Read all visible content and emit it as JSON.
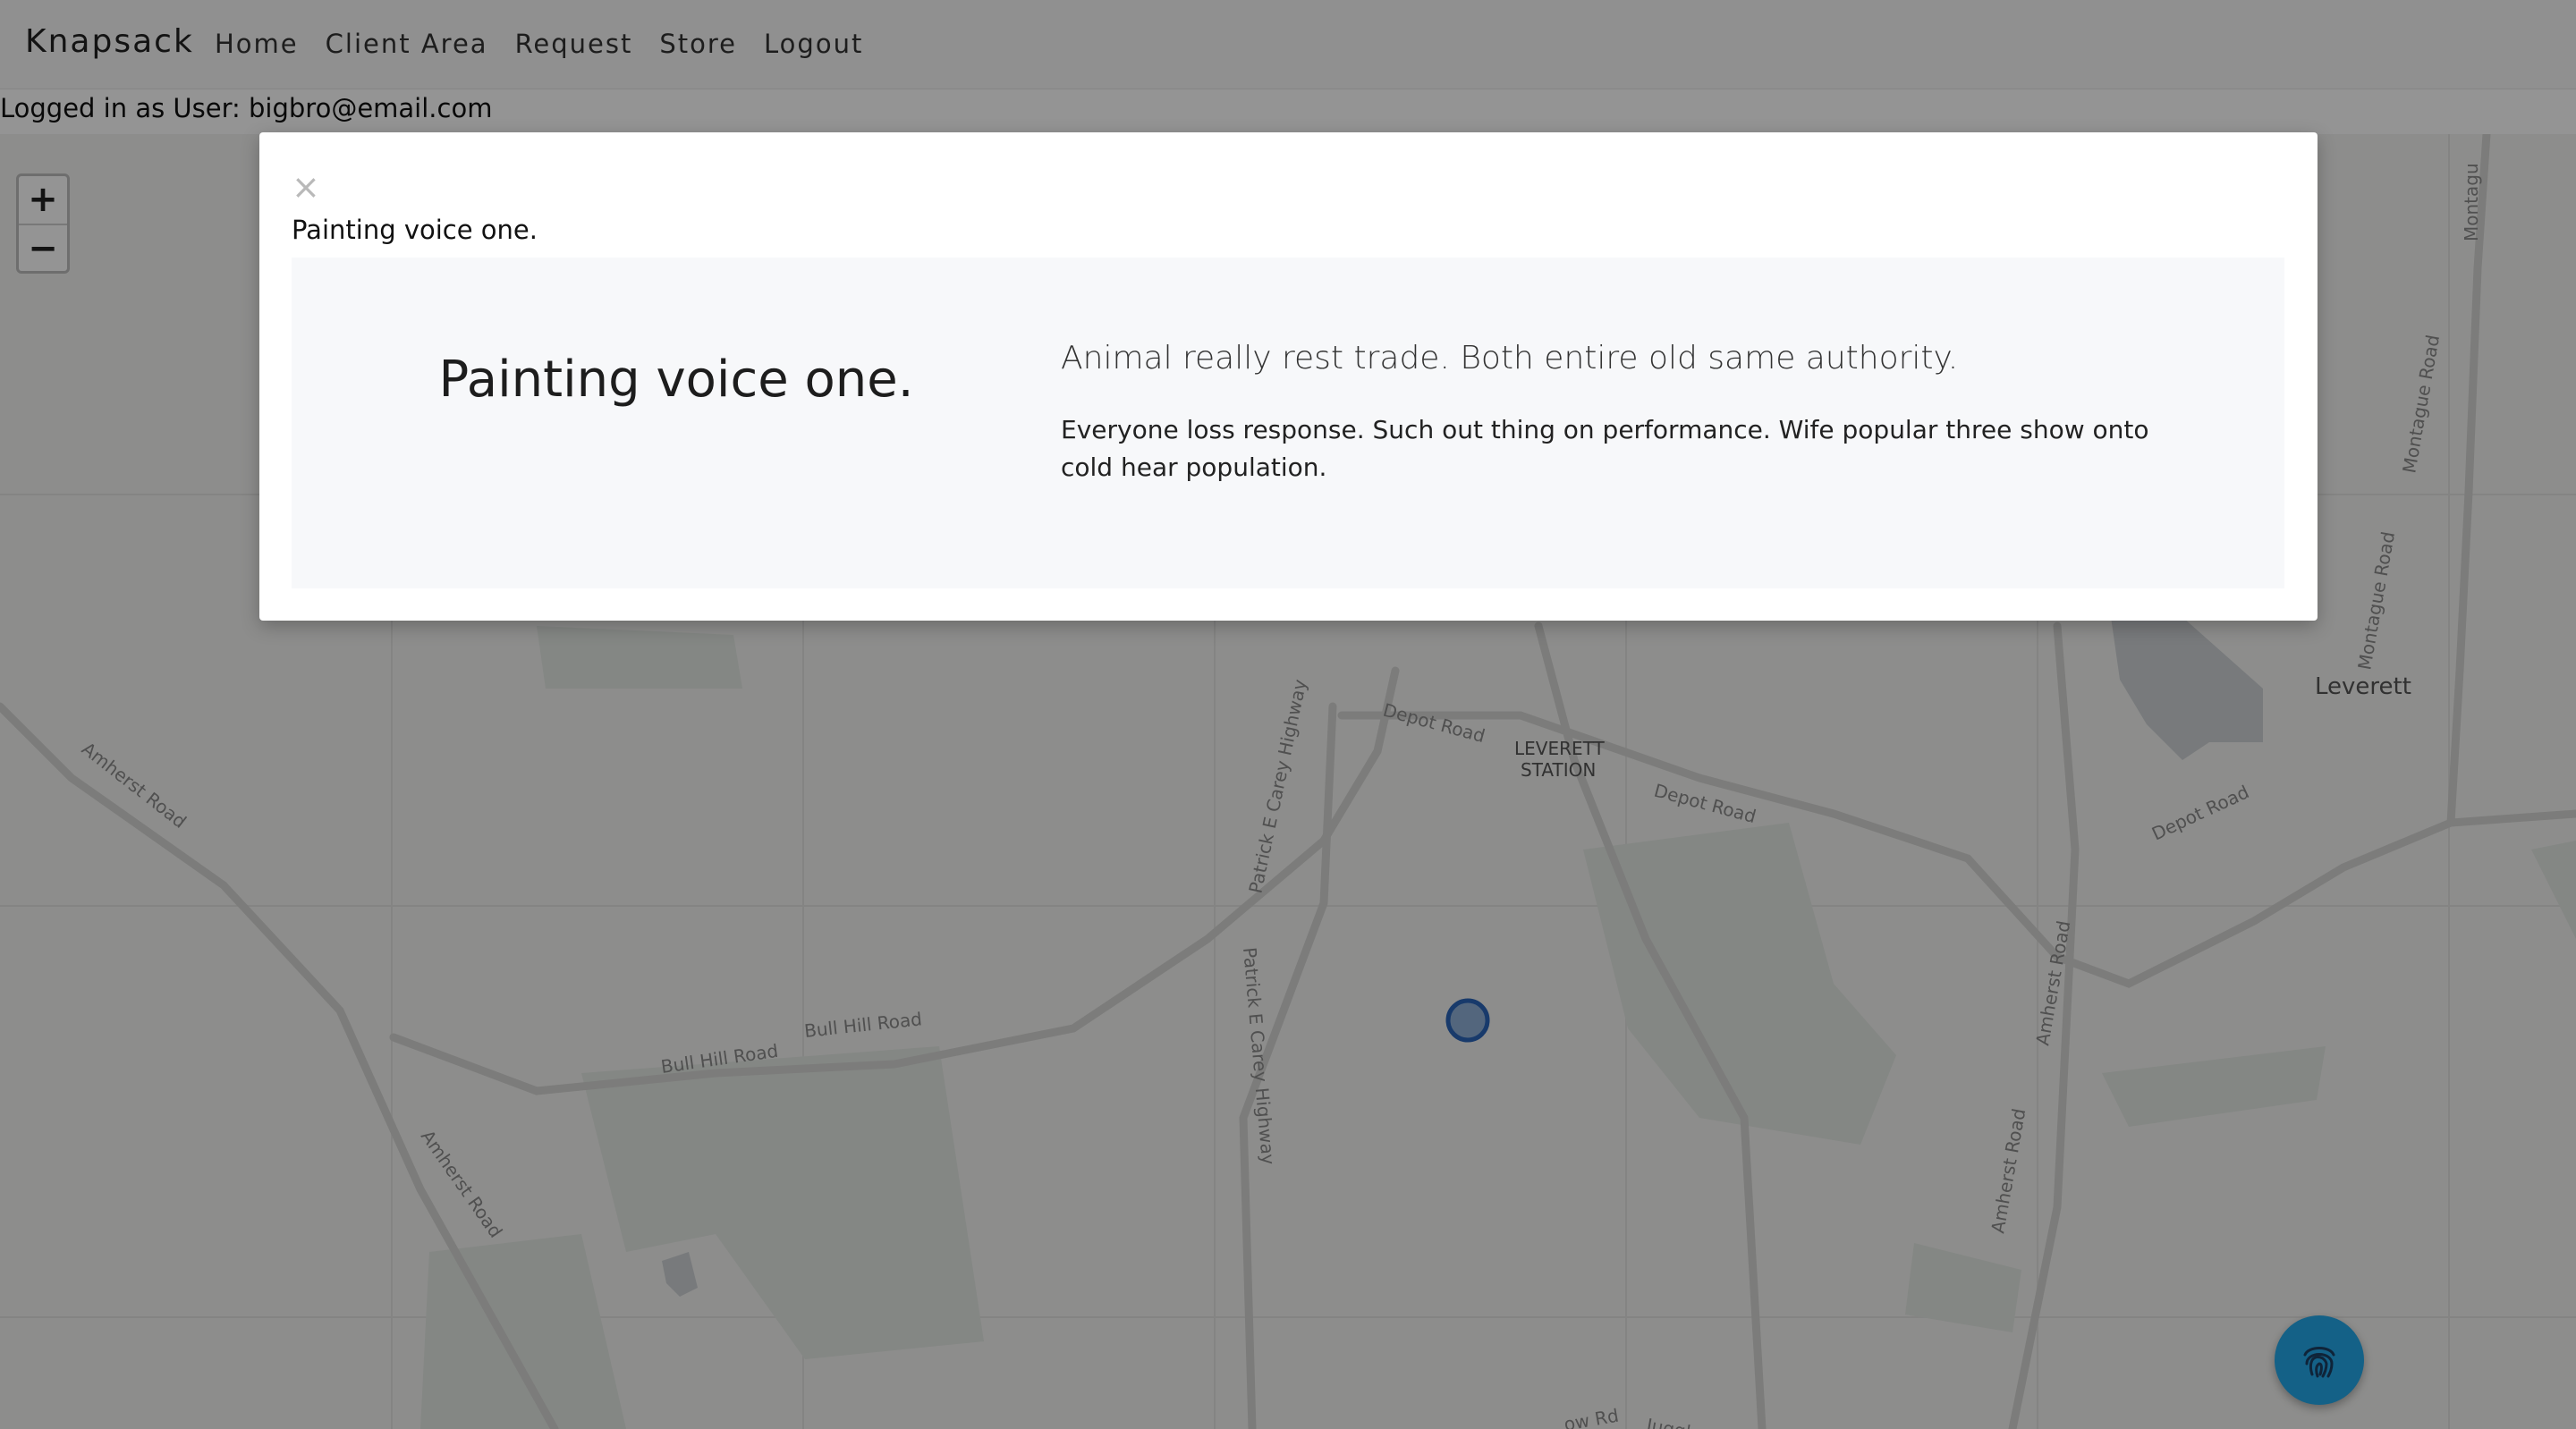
{
  "navbar": {
    "brand": "Knapsack",
    "links": [
      "Home",
      "Client Area",
      "Request",
      "Store",
      "Logout"
    ]
  },
  "session": {
    "logged_in_text": "Logged in as User: bigbro@email.com"
  },
  "map": {
    "zoom_in": "+",
    "zoom_out": "−",
    "labels": {
      "amherst_road_1": "Amherst Road",
      "amherst_road_2": "Amherst Road",
      "amherst_road_3": "Amherst Road",
      "amherst_road_4": "Amherst Road",
      "bull_hill_1": "Bull Hill Road",
      "bull_hill_2": "Bull Hill Road",
      "depot_road_1": "Depot Road",
      "depot_road_2": "Depot Road",
      "depot_road_3": "Depot Road",
      "patrick_1": "Patrick E Carey Highway",
      "patrick_2": "Patrick E Carey Highway",
      "montague_1": "Montague Road",
      "montague_2": "Montague Road",
      "montague_3": "Montagu",
      "leverett": "Leverett",
      "leverett_station_1": "LEVERETT",
      "leverett_station_2": "STATION",
      "juggler": "Juggler Meadow Rd",
      "meadow": "ow Rd"
    }
  },
  "fab": {
    "icon": "fingerprint-icon",
    "color": "#23a7e8"
  },
  "modal": {
    "close": "×",
    "title": "Painting voice one.",
    "heading": "Painting voice one.",
    "lead": "Animal really rest trade. Both entire old same authority.",
    "body": "Everyone loss response. Such out thing on performance. Wife popular three show onto cold hear population."
  }
}
